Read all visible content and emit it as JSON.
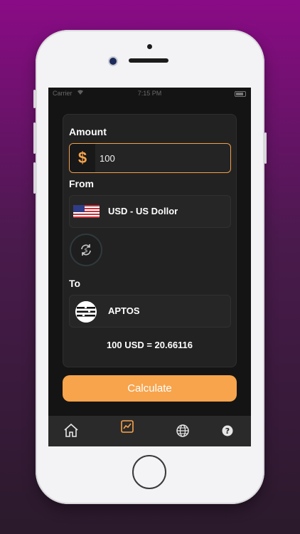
{
  "status_bar": {
    "carrier": "Carrier",
    "time": "7:15 PM"
  },
  "converter": {
    "amount_label": "Amount",
    "currency_symbol": "$",
    "amount_value": "100",
    "from_label": "From",
    "from_currency": "USD - US Dollor",
    "to_label": "To",
    "to_currency": "APTOS",
    "result": "100 USD = 20.66116"
  },
  "calculate_label": "Calculate",
  "icons": {
    "swap": "swap-icon",
    "home": "home-icon",
    "chart": "chart-icon",
    "globe": "globe-icon",
    "help": "help-icon"
  },
  "colors": {
    "accent": "#f7a44c",
    "background": "#141414",
    "card": "#222222"
  }
}
